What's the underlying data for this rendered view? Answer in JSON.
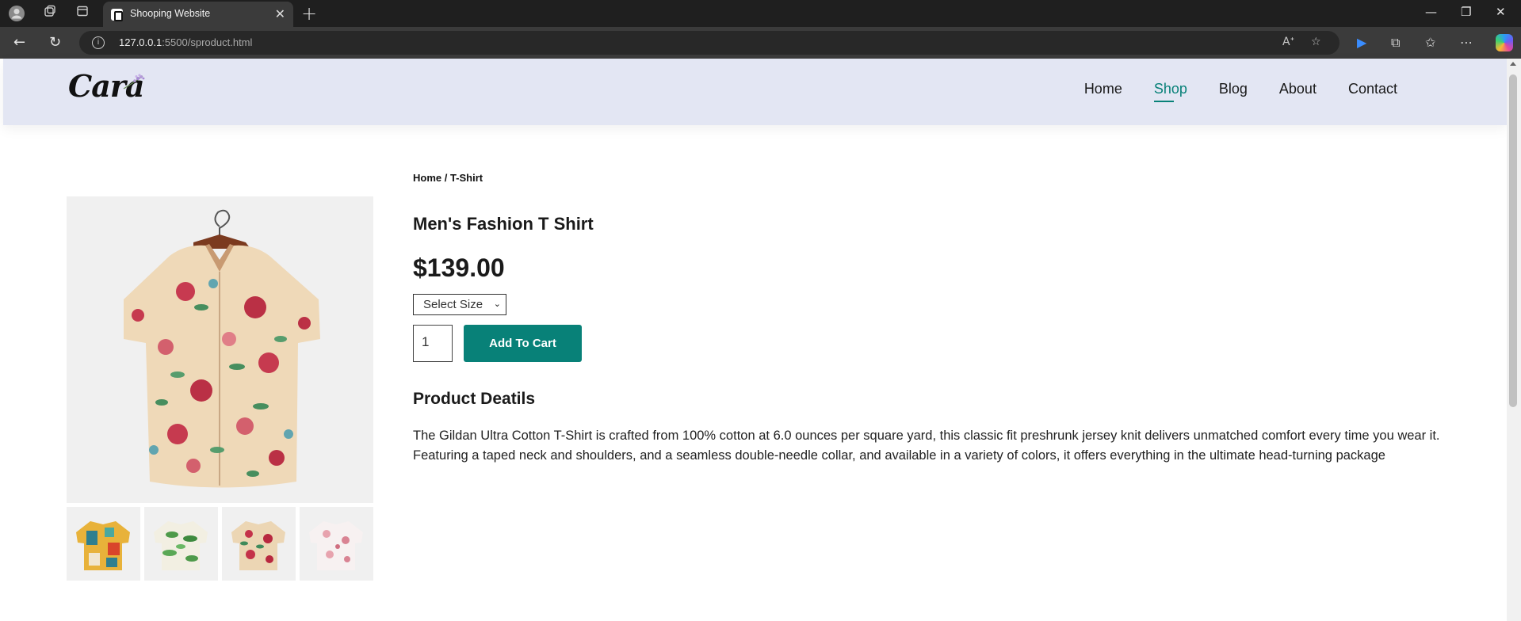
{
  "browser": {
    "tab_title": "Shooping Website",
    "url_host": "127.0.0.1",
    "url_path": ":5500/sproduct.html"
  },
  "site": {
    "logo": "Cara",
    "nav": [
      {
        "label": "Home",
        "active": false
      },
      {
        "label": "Shop",
        "active": true
      },
      {
        "label": "Blog",
        "active": false
      },
      {
        "label": "About",
        "active": false
      },
      {
        "label": "Contact",
        "active": false
      }
    ]
  },
  "product": {
    "breadcrumb": "Home / T-Shirt",
    "title": "Men's Fashion T Shirt",
    "price": "$139.00",
    "size_select": "Select Size",
    "quantity": "1",
    "add_to_cart": "Add To Cart",
    "details_heading": "Product Deatils",
    "description": "The Gildan Ultra Cotton T-Shirt is crafted from 100% cotton at 6.0 ounces per square yard, this classic fit preshrunk jersey knit delivers unmatched comfort every time you wear it. Featuring a taped neck and shoulders, and a seamless double-needle collar, and available in a variety of colors, it offers everything in the ultimate head-turning package"
  },
  "colors": {
    "accent": "#088178",
    "header_bg": "#e3e6f3"
  }
}
